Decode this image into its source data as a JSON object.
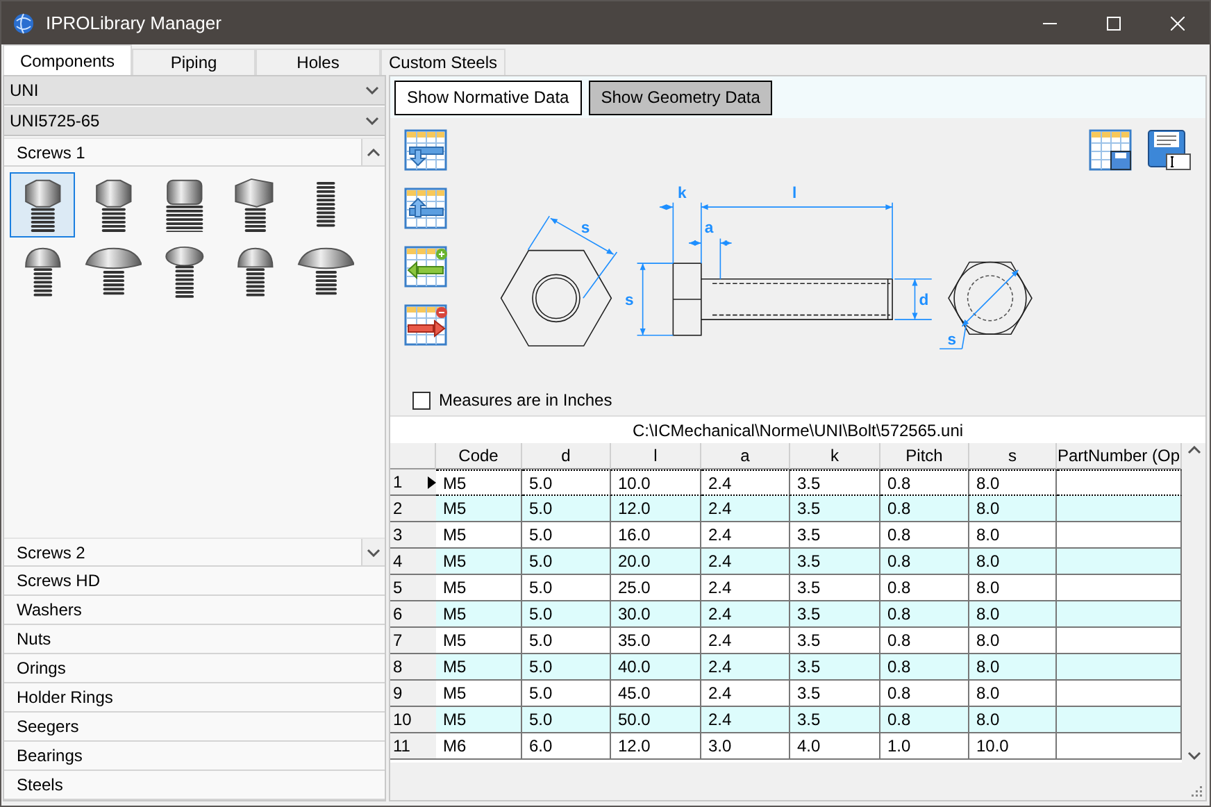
{
  "window": {
    "title": "IPROLibrary Manager"
  },
  "tabs": [
    {
      "label": "Components",
      "selected": true
    },
    {
      "label": "Piping",
      "selected": false
    },
    {
      "label": "Holes",
      "selected": false
    },
    {
      "label": "Custom Steels",
      "selected": false
    }
  ],
  "library": {
    "standard": "UNI",
    "norm": "UNI5725-65"
  },
  "categories": [
    {
      "label": "Screws 1",
      "kind": "section",
      "expanded": true,
      "thumbnails": [
        {
          "kind": "hex",
          "selected": true
        },
        {
          "kind": "hex",
          "selected": false
        },
        {
          "kind": "cylinder",
          "selected": false
        },
        {
          "kind": "square",
          "selected": false
        },
        {
          "kind": "stud",
          "selected": false
        },
        {
          "kind": "round",
          "selected": false
        },
        {
          "kind": "mushroom",
          "selected": false
        },
        {
          "kind": "flat",
          "selected": false
        },
        {
          "kind": "round",
          "selected": false
        },
        {
          "kind": "mushroom",
          "selected": false
        }
      ]
    },
    {
      "label": "Screws 2",
      "kind": "section",
      "expanded": false
    },
    {
      "label": "Screws HD",
      "kind": "item"
    },
    {
      "label": "Washers",
      "kind": "item"
    },
    {
      "label": "Nuts",
      "kind": "item"
    },
    {
      "label": "Orings",
      "kind": "item"
    },
    {
      "label": "Holder Rings",
      "kind": "item"
    },
    {
      "label": "Seegers",
      "kind": "item"
    },
    {
      "label": "Bearings",
      "kind": "item"
    },
    {
      "label": "Steels",
      "kind": "item"
    }
  ],
  "view_buttons": [
    {
      "label": "Show Normative Data",
      "selected": false
    },
    {
      "label": "Show Geometry Data",
      "selected": true
    }
  ],
  "diagram": {
    "labels": [
      "s",
      "k",
      "l",
      "a",
      "s",
      "d",
      "s"
    ]
  },
  "inches_checkbox": {
    "label": "Measures are in Inches",
    "checked": false
  },
  "table": {
    "file_path": "C:\\ICMechanical\\Norme\\UNI\\Bolt\\572565.uni",
    "columns": [
      "Code",
      "d",
      "l",
      "a",
      "k",
      "Pitch",
      "s",
      "PartNumber (Op"
    ],
    "rows": [
      {
        "index": "1",
        "current": true,
        "cells": [
          "M5",
          "5.0",
          "10.0",
          "2.4",
          "3.5",
          "0.8",
          "8.0"
        ]
      },
      {
        "index": "2",
        "current": false,
        "cells": [
          "M5",
          "5.0",
          "12.0",
          "2.4",
          "3.5",
          "0.8",
          "8.0"
        ]
      },
      {
        "index": "3",
        "current": false,
        "cells": [
          "M5",
          "5.0",
          "16.0",
          "2.4",
          "3.5",
          "0.8",
          "8.0"
        ]
      },
      {
        "index": "4",
        "current": false,
        "cells": [
          "M5",
          "5.0",
          "20.0",
          "2.4",
          "3.5",
          "0.8",
          "8.0"
        ]
      },
      {
        "index": "5",
        "current": false,
        "cells": [
          "M5",
          "5.0",
          "25.0",
          "2.4",
          "3.5",
          "0.8",
          "8.0"
        ]
      },
      {
        "index": "6",
        "current": false,
        "cells": [
          "M5",
          "5.0",
          "30.0",
          "2.4",
          "3.5",
          "0.8",
          "8.0"
        ]
      },
      {
        "index": "7",
        "current": false,
        "cells": [
          "M5",
          "5.0",
          "35.0",
          "2.4",
          "3.5",
          "0.8",
          "8.0"
        ]
      },
      {
        "index": "8",
        "current": false,
        "cells": [
          "M5",
          "5.0",
          "40.0",
          "2.4",
          "3.5",
          "0.8",
          "8.0"
        ]
      },
      {
        "index": "9",
        "current": false,
        "cells": [
          "M5",
          "5.0",
          "45.0",
          "2.4",
          "3.5",
          "0.8",
          "8.0"
        ]
      },
      {
        "index": "10",
        "current": false,
        "cells": [
          "M5",
          "5.0",
          "50.0",
          "2.4",
          "3.5",
          "0.8",
          "8.0"
        ]
      },
      {
        "index": "11",
        "current": false,
        "cells": [
          "M6",
          "6.0",
          "12.0",
          "3.0",
          "4.0",
          "1.0",
          "10.0"
        ]
      }
    ]
  }
}
